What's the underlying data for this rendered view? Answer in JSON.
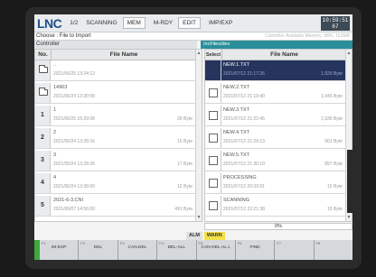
{
  "header": {
    "logo": "LNC",
    "page": "1/2",
    "mode": "SCANNING",
    "mem": "MEM",
    "status": "M-RDY",
    "edit": "EDIT",
    "impexp": "IMP/EXP",
    "clock_time": "10:59:51",
    "clock_sub": "67"
  },
  "title": "Choose : File to Import",
  "title_ghost": "Controller Available Memory: 98%, 152MB",
  "left_panel": {
    "label": "Controller",
    "col_no": "No.",
    "col_name": "File Name",
    "rows": [
      {
        "num": "",
        "icon": "folder",
        "name": "..",
        "date": "2021/06/25 13:24:12",
        "size": ""
      },
      {
        "num": "",
        "icon": "folder",
        "name": "14963",
        "date": "2021/06/24 13:30:08",
        "size": ""
      },
      {
        "num": "1",
        "icon": "",
        "name": "1",
        "date": "2021/06/25 16:29:08",
        "size": "26 Byte"
      },
      {
        "num": "2",
        "icon": "",
        "name": "2",
        "date": "2021/06/24 13:28:16",
        "size": "15 Byte"
      },
      {
        "num": "3",
        "icon": "",
        "name": "3",
        "date": "2021/05/24 13:28:26",
        "size": "17 Byte"
      },
      {
        "num": "4",
        "icon": "",
        "name": "4",
        "date": "2021/06/24 13:38:00",
        "size": "12 Byte"
      },
      {
        "num": "5",
        "icon": "",
        "name": "2021-6-3.CNI",
        "date": "2021/06/07 14:56:00",
        "size": "491 Byte"
      }
    ]
  },
  "right_panel": {
    "label": "/ncFiles/dev",
    "col_select": "Select",
    "col_name": "File Name",
    "rows": [
      {
        "name": "NEW.1.TXT",
        "date": "2021/07/12 21:17:26",
        "size": "1,926 Byte",
        "selected": true
      },
      {
        "name": "NEW.2.TXT",
        "date": "2021/07/12 21:19:40",
        "size": "1,946 Byte",
        "selected": false
      },
      {
        "name": "NEW.3.TXT",
        "date": "2021/07/12 21:22:45",
        "size": "1,936 Byte",
        "selected": false
      },
      {
        "name": "NEW.4.TXT",
        "date": "2021/07/12 21:29:13",
        "size": "901 Byte",
        "selected": false
      },
      {
        "name": "NEW.5.TXT",
        "date": "2021/07/12 21:30:10",
        "size": "897 Byte",
        "selected": false
      },
      {
        "name": "PROCESSING",
        "date": "2021/07/12 20:33:01",
        "size": "15 Byte",
        "selected": false
      },
      {
        "name": "SCANNING",
        "date": "2021/07/12 22:21:38",
        "size": "15 Byte",
        "selected": false
      }
    ]
  },
  "progress": {
    "label": "0%",
    "value": 0
  },
  "alarms": {
    "alm": "ALM",
    "warn": "WARN"
  },
  "softkeys": [
    {
      "fn": "F1",
      "label": "IM-EXP"
    },
    {
      "fn": "F2",
      "label": "DEL"
    },
    {
      "fn": "F3",
      "label": "CAN.DEL"
    },
    {
      "fn": "F4",
      "label": "DEL-ALL"
    },
    {
      "fn": "F5",
      "label": "CAN-DEL-AL L"
    },
    {
      "fn": "F6",
      "label": "FIND"
    },
    {
      "fn": "F7",
      "label": ""
    },
    {
      "fn": "F8",
      "label": ""
    }
  ],
  "colors": {
    "accent": "#2a8f9a",
    "selected_row": "#25355e",
    "warn": "#f3e04a",
    "logo": "#1f4d8a"
  }
}
